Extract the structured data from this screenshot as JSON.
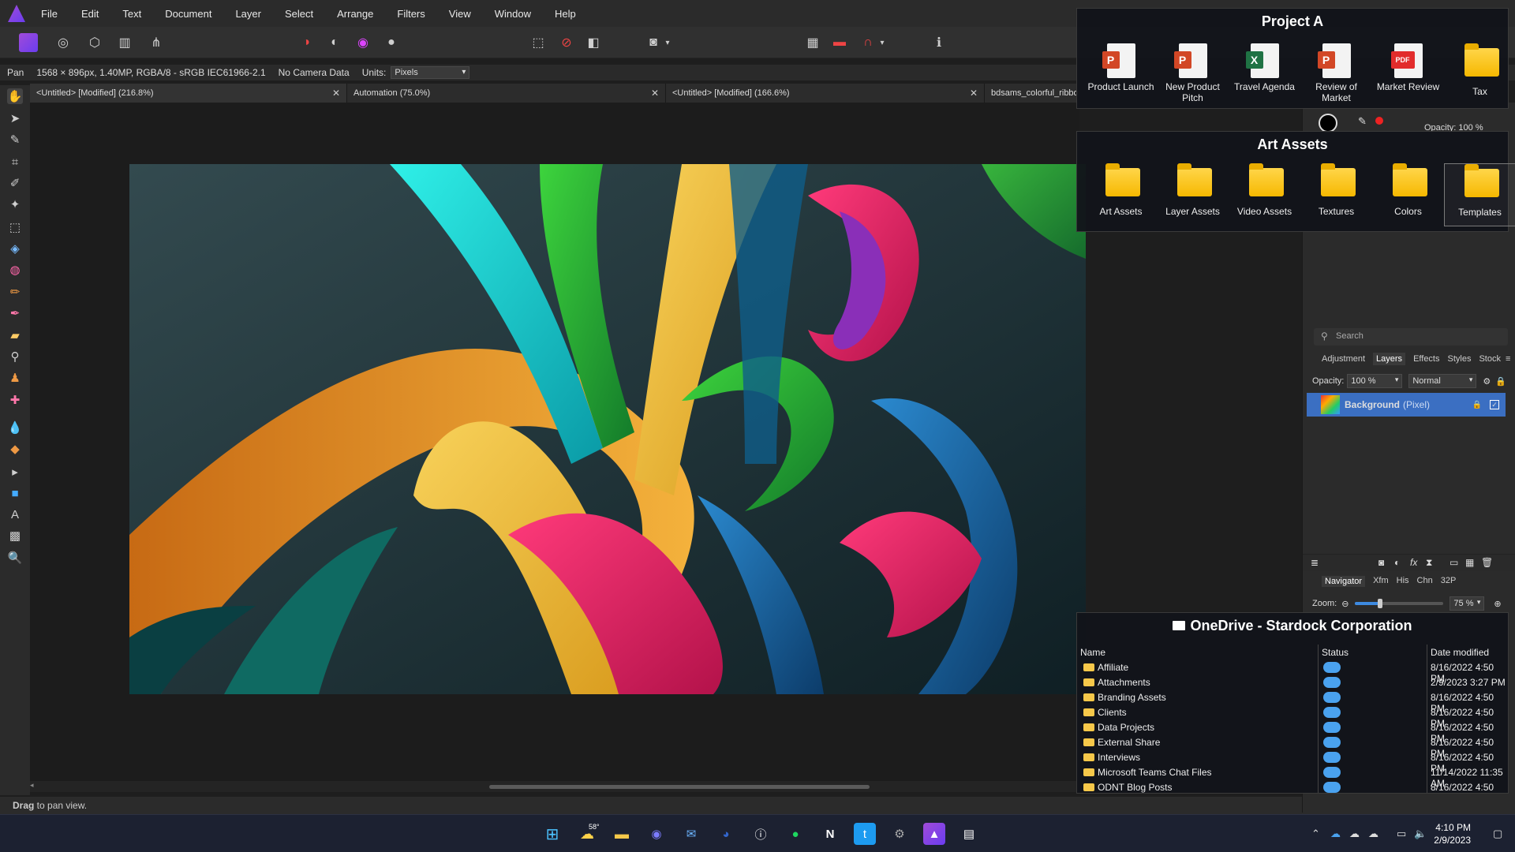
{
  "menubar": {
    "items": [
      "File",
      "Edit",
      "Text",
      "Document",
      "Layer",
      "Select",
      "Arrange",
      "Filters",
      "View",
      "Window",
      "Help"
    ]
  },
  "context": {
    "tool": "Pan",
    "info": "1568 × 896px, 1.40MP, RGBA/8 - sRGB IEC61966-2.1",
    "camera": "No Camera Data",
    "units_label": "Units:",
    "units_value": "Pixels"
  },
  "tabs": [
    {
      "label": "<Untitled> [Modified] (216.8%)"
    },
    {
      "label": "Automation (75.0%)"
    },
    {
      "label": "<Untitled> [Modified] (166.6%)"
    },
    {
      "label": "bdsams_colorful_ribbo"
    }
  ],
  "status": {
    "bold": "Drag",
    "text": " to pan view."
  },
  "fence_project": {
    "title": "Project A",
    "items": [
      {
        "label": "Product Launch",
        "kind": "powerpoint",
        "badge": "P",
        "color": "#d24726"
      },
      {
        "label": "New Product Pitch",
        "kind": "powerpoint",
        "badge": "P",
        "color": "#d24726"
      },
      {
        "label": "Travel Agenda",
        "kind": "excel",
        "badge": "X",
        "color": "#1f7244"
      },
      {
        "label": "Review of Market",
        "kind": "powerpoint",
        "badge": "P",
        "color": "#d24726"
      },
      {
        "label": "Market Review",
        "kind": "pdf",
        "badge": "PDF",
        "color": "#e22c2c"
      },
      {
        "label": "Tax",
        "kind": "folder"
      }
    ]
  },
  "fence_art": {
    "title": "Art Assets",
    "items": [
      {
        "label": "Art Assets"
      },
      {
        "label": "Layer Assets"
      },
      {
        "label": "Video Assets"
      },
      {
        "label": "Textures"
      },
      {
        "label": "Colors"
      },
      {
        "label": "Templates"
      }
    ]
  },
  "panel": {
    "opacity_top": "Opacity:  100 %",
    "search_placeholder": "Search",
    "tabs": [
      "Adjustment",
      "Layers",
      "Effects",
      "Styles",
      "Stock"
    ],
    "active_tab": "Layers",
    "opacity_label": "Opacity:",
    "opacity_value": "100 %",
    "blend_mode": "Normal",
    "layer_name": "Background",
    "layer_type": "(Pixel)",
    "nav_tabs": [
      "Navigator",
      "Xfm",
      "His",
      "Chn",
      "32P"
    ],
    "zoom_label": "Zoom:",
    "zoom_value": "75 %",
    "zoom_fraction": 0.28
  },
  "onedrive": {
    "title": "OneDrive - Stardock Corporation",
    "columns": [
      "Name",
      "Status",
      "Date modified"
    ],
    "rows": [
      {
        "name": "Affiliate",
        "date": "8/16/2022 4:50 PM"
      },
      {
        "name": "Attachments",
        "date": "2/9/2023 3:27 PM"
      },
      {
        "name": "Branding Assets",
        "date": "8/16/2022 4:50 PM"
      },
      {
        "name": "Clients",
        "date": "8/16/2022 4:50 PM"
      },
      {
        "name": "Data Projects",
        "date": "8/16/2022 4:50 PM"
      },
      {
        "name": "External Share",
        "date": "8/16/2022 4:50 PM"
      },
      {
        "name": "Interviews",
        "date": "8/16/2022 4:50 PM"
      },
      {
        "name": "Microsoft Teams Chat Files",
        "date": "11/14/2022 11:35 AM"
      },
      {
        "name": "ODNT Blog Posts",
        "date": "8/16/2022 4:50 PM"
      }
    ]
  },
  "taskbar": {
    "weather": "58°",
    "time": "4:10 PM",
    "date": "2/9/2023"
  }
}
